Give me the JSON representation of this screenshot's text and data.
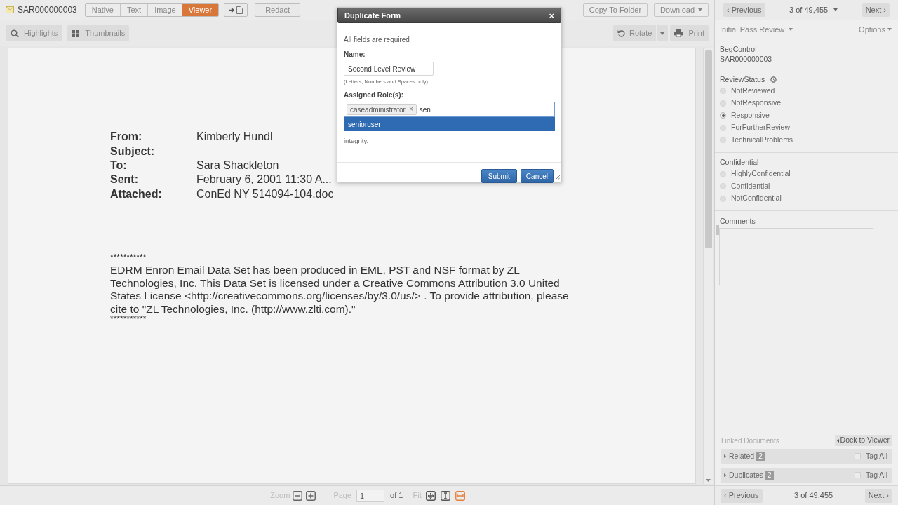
{
  "top_bar": {
    "doc_id": "SAR000000003",
    "view_tabs": [
      {
        "label": "Native",
        "selected": false
      },
      {
        "label": "Text",
        "selected": false
      },
      {
        "label": "Image",
        "selected": false
      },
      {
        "label": "Viewer",
        "selected": true
      }
    ],
    "redact": "Redact",
    "copy_to_folder": "Copy To Folder",
    "download": "Download"
  },
  "toolbar": {
    "highlights": "Highlights",
    "thumbnails": "Thumbnails",
    "rotate": "Rotate",
    "print": "Print"
  },
  "document": {
    "headers": [
      {
        "label": "From:",
        "value": "Kimberly Hundl"
      },
      {
        "label": "Subject:"
      },
      {
        "label": "To:",
        "value": "Sara Shackleton"
      },
      {
        "label": "Sent:",
        "value": "February 6, 2001 11:30 A..."
      },
      {
        "label": "Attached:",
        "value": "ConEd NY 514094-104.doc"
      }
    ],
    "stars_top": "***********",
    "body": "EDRM Enron Email Data Set has been produced in EML, PST and NSF format by ZL Technologies, Inc. This Data Set is licensed under a Creative Commons Attribution 3.0 United States License <http://creativecommons.org/licenses/by/3.0/us/> . To provide attribution, please cite to \"ZL Technologies, Inc. (http://www.zlti.com).\"",
    "stars_bottom": "***********"
  },
  "bottom_bar": {
    "zoom_label": "Zoom",
    "page_label": "Page",
    "page_value": "1",
    "page_of": "of 1",
    "fit_label": "Fit",
    "fit_modes": [
      {
        "kind": "page",
        "selected": false
      },
      {
        "kind": "height",
        "selected": false
      },
      {
        "kind": "width",
        "selected": true
      }
    ]
  },
  "navigation": {
    "previous": "‹ Previous",
    "position": "3 of 49,455",
    "next": "Next ›"
  },
  "review_panel": {
    "layout": "Initial Pass Review",
    "options": "Options",
    "field": {
      "label": "BegControl",
      "value": "SAR000000003"
    },
    "groups": [
      {
        "title": "ReviewStatus",
        "options": [
          {
            "label": "NotReviewed",
            "selected": false
          },
          {
            "label": "NotResponsive",
            "selected": false
          },
          {
            "label": "Responsive",
            "selected": true
          },
          {
            "label": "ForFurtherReview",
            "selected": false
          },
          {
            "label": "TechnicalProblems",
            "selected": false
          }
        ]
      },
      {
        "title": "Confidential",
        "options": [
          {
            "label": "HighlyConfidential",
            "selected": false
          },
          {
            "label": "Confidential",
            "selected": false
          },
          {
            "label": "NotConfidential",
            "selected": false
          }
        ]
      }
    ],
    "comments_label": "Comments"
  },
  "linked_documents": {
    "title": "Linked Documents",
    "dock": "Dock to Viewer",
    "groups": [
      {
        "label": "Related",
        "count": "2",
        "tag_all": "Tag All",
        "checked": false
      },
      {
        "label": "Duplicates",
        "count": "2",
        "tag_all": "Tag All",
        "checked": false
      }
    ]
  },
  "bottom_navigation": {
    "previous": "‹ Previous",
    "position": "3 of 49,455",
    "next": "Next ›"
  },
  "dialog": {
    "title": "Duplicate Form",
    "close": "×",
    "note": "All fields are required",
    "name_label": "Name:",
    "name_value": "Second Level Review",
    "name_hint": "(Letters, Numbers and Spaces only)",
    "roles_label": "Assigned Role(s):",
    "roles": [
      {
        "label": "caseadministrator",
        "remove": "×"
      }
    ],
    "role_query": "sen",
    "suggestions": [
      {
        "label": "senioruser",
        "selected": true
      }
    ],
    "hidden_text_tail": "integrity.",
    "submit": "Submit",
    "cancel": "Cancel"
  }
}
